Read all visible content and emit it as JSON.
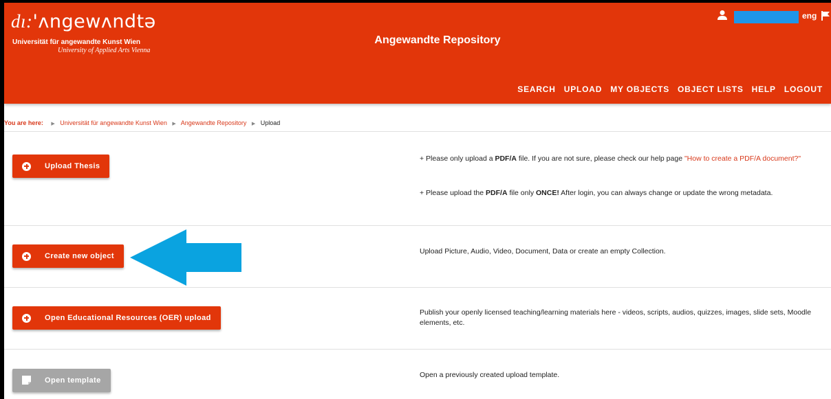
{
  "header": {
    "logo_prefix": "dı:",
    "logo_main": "'ʌngewʌndtə",
    "logo_sub1": "Universität für angewandte Kunst Wien",
    "logo_sub2": "University of Applied Arts Vienna",
    "site_title": "Angewandte Repository",
    "language": "eng",
    "nav": [
      "SEARCH",
      "UPLOAD",
      "MY OBJECTS",
      "OBJECT LISTS",
      "HELP",
      "LOGOUT"
    ]
  },
  "breadcrumb": {
    "lead": "You are here:",
    "items": [
      "Universität für angewandte Kunst Wien",
      "Angewandte Repository"
    ],
    "current": "Upload"
  },
  "sections": [
    {
      "button": "Upload Thesis",
      "lines": [
        {
          "a": "+ Please only upload a ",
          "b": "PDF/A",
          "c": " file. If you are not sure, please check our help page ",
          "link": "\"How to create a PDF/A document?\""
        },
        {
          "a": "+ Please upload the ",
          "b": "PDF/A",
          "c": " file only ",
          "d": "ONCE!",
          "e": " After login, you can always change or update the wrong metadata."
        }
      ]
    },
    {
      "button": "Create new object",
      "text": "Upload Picture, Audio, Video, Document, Data or create an empty Collection."
    },
    {
      "button": "Open Educational Resources (OER) upload",
      "text": "Publish your openly licensed teaching/learning materials here - videos, scripts, audios, quizzes, images, slide sets, Moodle elements, etc."
    },
    {
      "button": "Open template",
      "text": "Open a previously created upload template."
    }
  ],
  "colors": {
    "brand": "#e2360a",
    "annotation_arrow": "#0aa3e0",
    "disabled_button": "#a6a6a6"
  },
  "icons": [
    "user-icon",
    "flag-icon",
    "plus-circle-icon",
    "chevron-right-icon",
    "template-icon",
    "annotation-arrow-icon"
  ]
}
